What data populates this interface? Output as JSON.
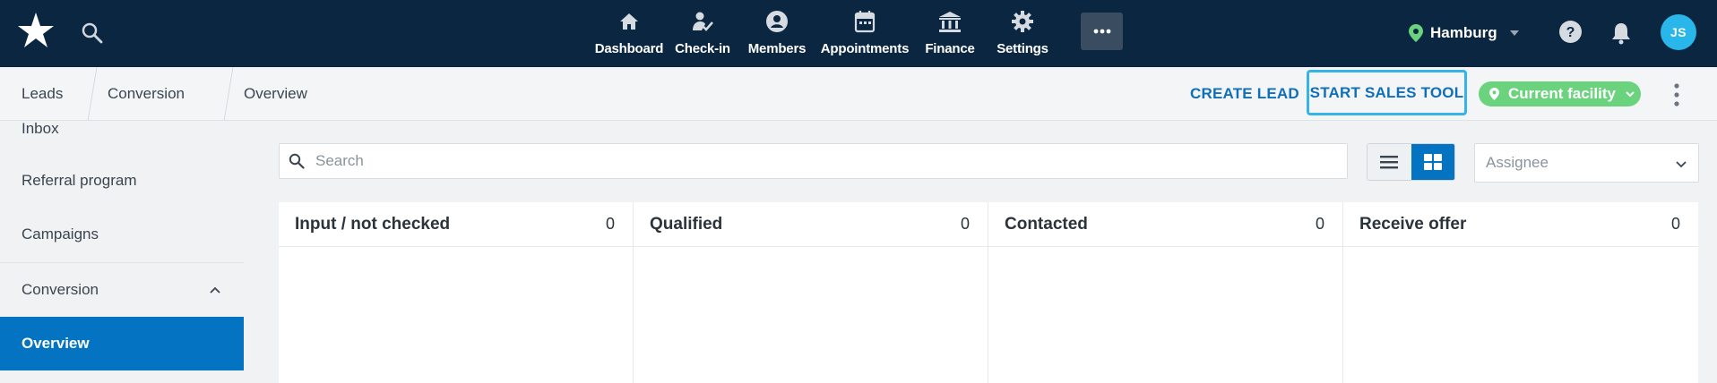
{
  "topnav": {
    "items": [
      {
        "label": "Dashboard",
        "icon": "home-icon"
      },
      {
        "label": "Check-in",
        "icon": "checkin-icon"
      },
      {
        "label": "Members",
        "icon": "members-icon"
      },
      {
        "label": "Appointments",
        "icon": "calendar-icon"
      },
      {
        "label": "Finance",
        "icon": "bank-icon"
      },
      {
        "label": "Settings",
        "icon": "gear-icon"
      }
    ],
    "more_icon": "more-dots-icon",
    "location": "Hamburg",
    "avatar_initials": "JS",
    "colors": {
      "bar": "#0b2640",
      "avatar": "#29b6ea",
      "location_pin": "#6bd27e"
    }
  },
  "breadcrumb": [
    "Leads",
    "Conversion",
    "Overview"
  ],
  "actions": {
    "create_lead": "CREATE LEAD",
    "start_sales_tool": "START SALES TOOL",
    "facility": "Current facility"
  },
  "sidebar": {
    "items": [
      "Inbox",
      "Referral program",
      "Campaigns"
    ],
    "section": "Conversion",
    "active": "Overview"
  },
  "main": {
    "search_placeholder": "Search",
    "assignee_placeholder": "Assignee",
    "columns": [
      {
        "title": "Input / not checked",
        "count": "0"
      },
      {
        "title": "Qualified",
        "count": "0"
      },
      {
        "title": "Contacted",
        "count": "0"
      },
      {
        "title": "Receive offer",
        "count": "0"
      }
    ]
  }
}
